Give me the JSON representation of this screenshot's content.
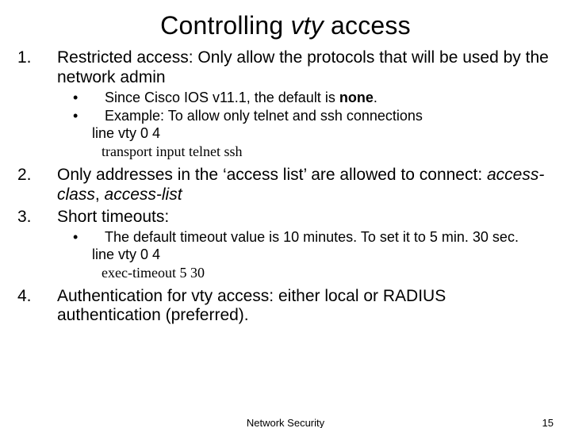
{
  "title_1": "Controlling ",
  "title_2": "vty",
  "title_3": " access",
  "items": [
    {
      "num": "1.",
      "text": "Restricted access: Only allow the protocols that will be used by the network admin"
    },
    {
      "num": "2.",
      "text_1": "Only addresses in the ‘access list’ are allowed to connect: ",
      "text_2": "access-class",
      "text_3": ", ",
      "text_4": "access-list"
    },
    {
      "num": "3.",
      "text": "Short timeouts:"
    },
    {
      "num": "4.",
      "text": "Authentication for vty access: either local or RADIUS authentication (preferred)."
    }
  ],
  "sub1": {
    "b1_a": "Since Cisco IOS v11.1, the default is ",
    "b1_b": "none",
    "b1_c": ".",
    "b2": "Example: To allow only telnet and ssh connections",
    "code1": "line vty 0 4",
    "code2": "transport input telnet ssh"
  },
  "sub3": {
    "b1": "The default timeout value is 10 minutes. To set it to 5 min. 30 sec.",
    "code1": "line vty 0 4",
    "code2": "exec-timeout 5 30"
  },
  "footer": {
    "center": "Network Security",
    "right": "15"
  }
}
